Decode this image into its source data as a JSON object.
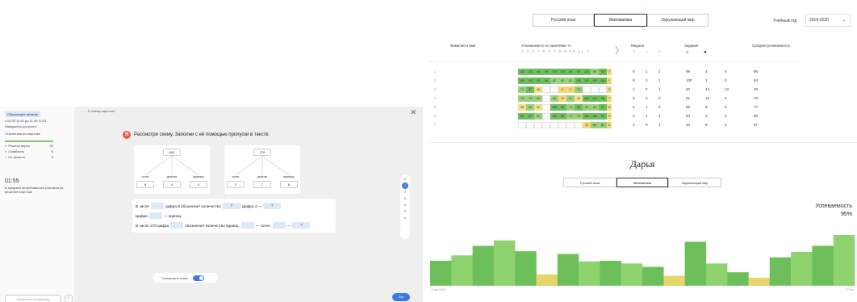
{
  "left": {
    "sidebar": {
      "tag": "Обучающее занятие",
      "date": "с 02.09 11:51 до 11.09 11:51",
      "deadline": "Завершено досрочно",
      "stats_title": "Статистика по карточке",
      "stats": [
        {
          "label": "Решено верно",
          "value": "32"
        },
        {
          "label": "Ошибочно",
          "value": "6"
        },
        {
          "label": "Не решено",
          "value": "5"
        }
      ],
      "time": "01:55",
      "time_note": "В среднем потребовалось учеников на решение карточки",
      "finish_btn": "Закончить тренировку",
      "more_btn": "···"
    },
    "back_link": "← К списку карточек",
    "close": "✕",
    "task_icon": "Я",
    "task_text": "Рассмотри схему. Заполни с её помощью пропуски в тексте.",
    "trees": [
      {
        "top": "840",
        "heads": [
          "сотни",
          "десятки",
          "единицы"
        ],
        "cells": [
          "8",
          "4",
          "0"
        ]
      },
      {
        "top": "276",
        "heads": [
          "сотни",
          "десятки",
          "единицы"
        ],
        "cells": [
          "2",
          "7",
          "6"
        ]
      }
    ],
    "sentence": {
      "l1a": "В числе",
      "l1b": "цифра 8 обозначает количество",
      "l1v": "?",
      "l1c": "Цифра 4 —",
      "l1v2": "?",
      "l2a": "Цифра",
      "l2b": "— единиц.",
      "l3a": "В числе 276 цифра",
      "l3b": "обозначает количество единиц,",
      "l3c": "— сотен.",
      "l3d": "—",
      "l3v": "?"
    },
    "pager": [
      "∧",
      "1",
      "2",
      "3",
      "4",
      "5",
      "∨"
    ],
    "toggle_label": "Посмотреть ответ",
    "chat_label": "Чат"
  },
  "right": {
    "top_hidden": "...",
    "subjects": [
      "Русский язык",
      "Математика",
      "Окружающий мир"
    ],
    "selected_subject": "Математика",
    "year_label": "Учебный год",
    "year_value": "2019-2020",
    "year_caret": "⌄",
    "headers": {
      "name": "Фамилия и имя",
      "perf": "Успеваемость по занятиям, %",
      "lesson_nums": "1 2 3 4 5 6 7 8 9 10 11 1",
      "medals": "Медали",
      "tasks": "Задания",
      "avg": "Средняя успеваемость",
      "arrow": "〉"
    },
    "medal_icons": [
      "★",
      "●",
      "●"
    ],
    "task_icons": [
      "✔",
      "✖"
    ],
    "rows": [
      {
        "n": "1",
        "scores": [
          "100",
          "100",
          "94",
          "86",
          "100",
          "100",
          "86",
          "97",
          "100",
          "80",
          "95",
          "7"
        ],
        "medals": [
          "8",
          "1",
          "2"
        ],
        "tasks": [
          "99",
          "2",
          "0"
        ],
        "avg": "95"
      },
      {
        "n": "2",
        "scores": [
          "100",
          "100",
          "93",
          "94",
          "82",
          "82",
          "81",
          "100",
          "100",
          "100",
          "100",
          "1"
        ],
        "medals": [
          "8",
          "3",
          "1"
        ],
        "tasks": [
          "100",
          "1",
          "0"
        ],
        "avg": "94"
      },
      {
        "n": "3",
        "scores": [
          "79",
          "87",
          "46",
          "",
          "",
          "8",
          "0",
          "73",
          "",
          "",
          "",
          "3"
        ],
        "medals": [
          "1",
          "0",
          "1"
        ],
        "tasks": [
          "40",
          "14",
          "13"
        ],
        "avg": "48"
      },
      {
        "n": "4",
        "scores": [
          "73",
          "73",
          "81",
          "",
          "64",
          "23",
          "67",
          "44",
          "100",
          "100",
          "95",
          "7"
        ],
        "medals": [
          "3",
          "2",
          "0"
        ],
        "tasks": [
          "81",
          "15",
          "0"
        ],
        "avg": "75"
      },
      {
        "n": "5",
        "scores": [
          "58",
          "60",
          "52",
          "",
          "100",
          "92",
          "75",
          "92",
          "62",
          "82",
          "97",
          "8"
        ],
        "medals": [
          "2",
          "1",
          "3"
        ],
        "tasks": [
          "88",
          "8",
          "0"
        ],
        "avg": "77"
      },
      {
        "n": "6",
        "scores": [
          "85",
          "87",
          "82",
          "",
          "100",
          "98",
          "73",
          "78",
          "100",
          "88",
          "94",
          "9"
        ],
        "medals": [
          "4",
          "1",
          "4"
        ],
        "tasks": [
          "94",
          "2",
          "0"
        ],
        "avg": "90"
      },
      {
        "n": "7",
        "scores": [
          "",
          "",
          "",
          "",
          "",
          "",
          "",
          "",
          "11",
          "80",
          "80",
          "8"
        ],
        "medals": [
          "1",
          "0",
          "1"
        ],
        "tasks": [
          "43",
          "9",
          "2"
        ],
        "avg": "67"
      }
    ],
    "student_name": "Дарья",
    "student_subjects": [
      "Русский язык",
      "Математика",
      "Окружающий мир"
    ],
    "perf_label": "Успеваемость",
    "perf_value": "95%",
    "axis_start": "16 авг 2019 г.",
    "axis_end": "27 сен"
  },
  "chart_data": {
    "type": "bar",
    "values": [
      37,
      45,
      59,
      67,
      51,
      17,
      47,
      36,
      37,
      33,
      28,
      15,
      65,
      33,
      20,
      12,
      42,
      50,
      59,
      75
    ],
    "ylim": [
      0,
      100
    ],
    "colors": [
      "#6cbf5a",
      "#8fd36e",
      "#b6d76a",
      "#e5d56a",
      "#f0cf6a"
    ]
  }
}
